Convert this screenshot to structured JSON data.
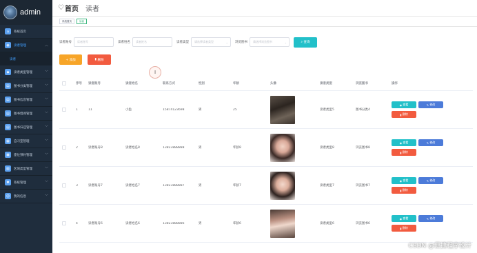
{
  "brand": {
    "name": "admin"
  },
  "sidebar": {
    "items": [
      {
        "label": "系统首页",
        "icon": "home-icon",
        "active": false,
        "has_children": false
      },
      {
        "label": "读者管理",
        "icon": "user-icon",
        "active": true,
        "has_children": true
      },
      {
        "label": "读者类型管理",
        "icon": "tag-icon",
        "active": false,
        "has_children": true
      },
      {
        "label": "图书分类管理",
        "icon": "book-icon",
        "active": false,
        "has_children": true
      },
      {
        "label": "图书信息管理",
        "icon": "book-icon",
        "active": false,
        "has_children": true
      },
      {
        "label": "图书借阅管理",
        "icon": "book-icon",
        "active": false,
        "has_children": true
      },
      {
        "label": "图书归还管理",
        "icon": "book-icon",
        "active": false,
        "has_children": true
      },
      {
        "label": "自习室管理",
        "icon": "room-icon",
        "active": false,
        "has_children": true
      },
      {
        "label": "座位预约管理",
        "icon": "seat-icon",
        "active": false,
        "has_children": true
      },
      {
        "label": "区域类型管理",
        "icon": "area-icon",
        "active": false,
        "has_children": true
      },
      {
        "label": "系统管理",
        "icon": "settings-icon",
        "active": false,
        "has_children": true
      },
      {
        "label": "我的信息",
        "icon": "profile-icon",
        "active": false,
        "has_children": true
      }
    ],
    "submenu_label": "读者"
  },
  "header": {
    "heart": "♡",
    "crumb_home": "首页",
    "crumb_current": "读者"
  },
  "tags": [
    {
      "label": "系统首页",
      "active": false
    },
    {
      "label": "读者",
      "active": true
    }
  ],
  "filters": {
    "f1_label": "读者账号",
    "f1_placeholder": "读者账号",
    "f2_label": "读者姓名",
    "f2_placeholder": "读者姓名",
    "f3_label": "读者类型",
    "f3_placeholder": "请选择读者类型",
    "f4_label": "浏览图书",
    "f4_placeholder": "请选择浏览图书",
    "search_label": "查询"
  },
  "actions": {
    "add_label": "+ 添加",
    "delete_label": "删除"
  },
  "table": {
    "columns": [
      "序号",
      "读者账号",
      "读者姓名",
      "联系方式",
      "性别",
      "年龄",
      "头像",
      "读者类型",
      "浏览图书",
      "操作"
    ],
    "rows": [
      {
        "idx": "1",
        "account": "11",
        "name": "小鱼",
        "phone": "15874123698",
        "gender": "男",
        "age": "25",
        "type": "读者类型5",
        "book": "图书分类4"
      },
      {
        "idx": "2",
        "account": "读者账号8",
        "name": "读者姓名8",
        "phone": "13823888888",
        "gender": "男",
        "age": "年龄8",
        "type": "读者类型8",
        "book": "浏览图书8"
      },
      {
        "idx": "3",
        "account": "读者账号7",
        "name": "读者姓名7",
        "phone": "13823888887",
        "gender": "男",
        "age": "年龄7",
        "type": "读者类型7",
        "book": "浏览图书7"
      },
      {
        "idx": "4",
        "account": "读者账号6",
        "name": "读者姓名6",
        "phone": "13823888886",
        "gender": "男",
        "age": "年龄6",
        "type": "读者类型6",
        "book": "浏览图书6"
      }
    ],
    "op_detail": "查看",
    "op_edit": "修改",
    "op_delete": "删除"
  },
  "watermark": "CSDN @便捷程序设计",
  "colors": {
    "sidebar_bg": "#1f2d3d",
    "accent": "#409eff",
    "search": "#22c0c9",
    "add": "#f7a528",
    "delete": "#f25b3f",
    "edit": "#4c7bd9"
  }
}
